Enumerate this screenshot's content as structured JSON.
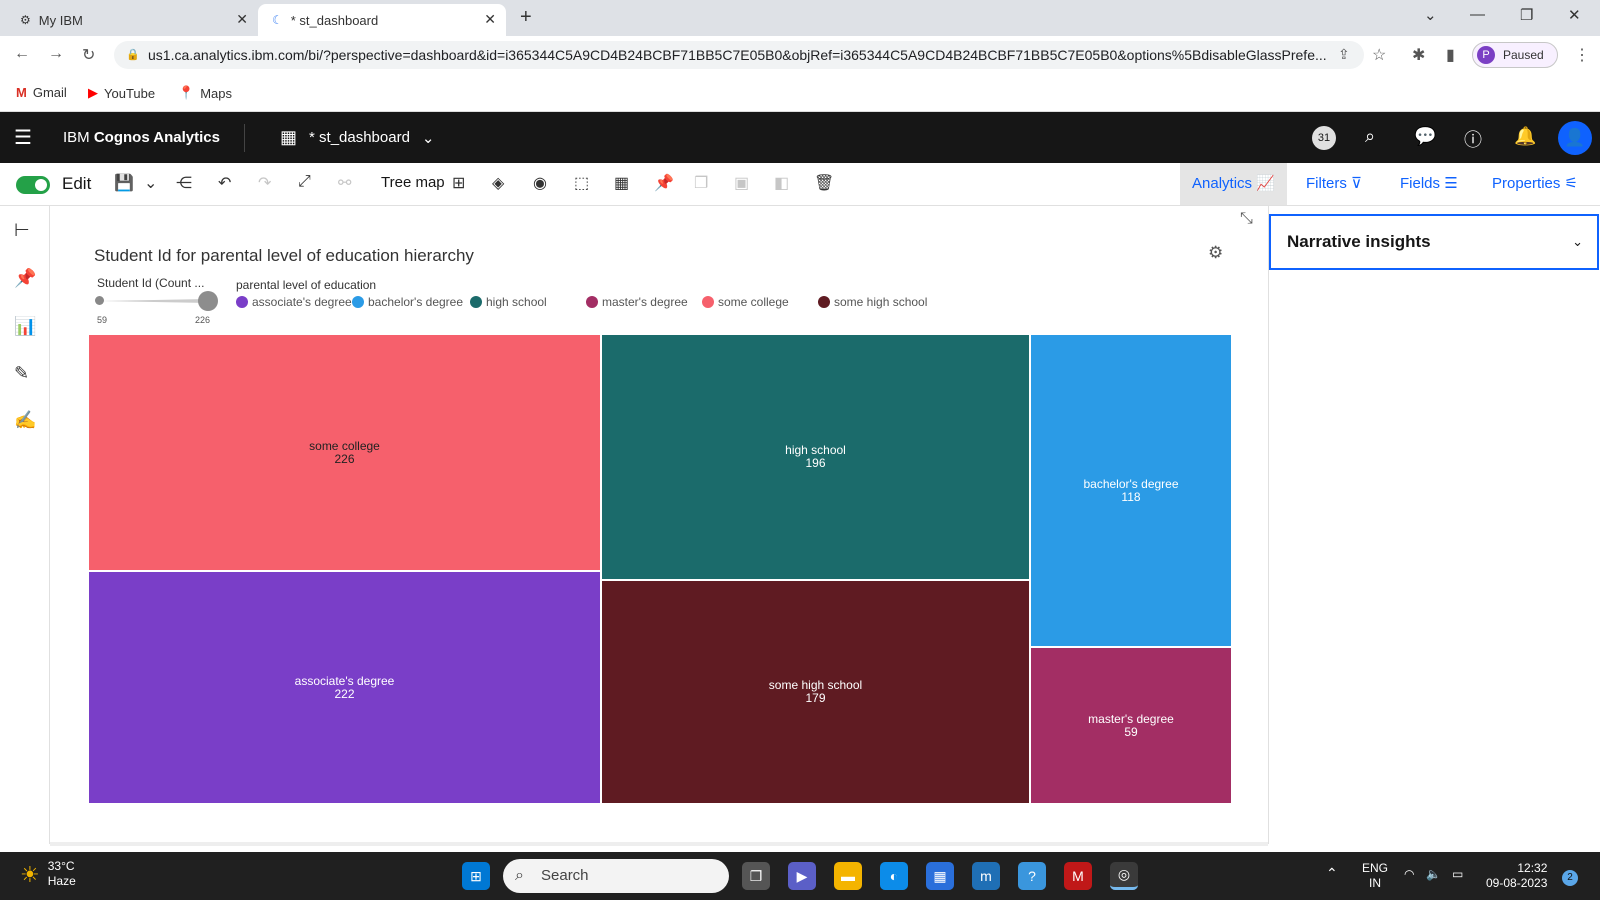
{
  "browser": {
    "tabs": [
      {
        "title": "My IBM"
      },
      {
        "title": "* st_dashboard"
      }
    ],
    "url": "us1.ca.analytics.ibm.com/bi/?perspective=dashboard&id=i365344C5A9CD4B24BCBF71BB5C7E05B0&objRef=i365344C5A9CD4B24BCBF71BB5C7E05B0&options%5BdisableGlassPrefe...",
    "profile_initial": "P",
    "profile_status": "Paused",
    "bookmarks": [
      "Gmail",
      "YouTube",
      "Maps"
    ]
  },
  "app": {
    "brand_prefix": "IBM ",
    "brand_name": "Cognos Analytics",
    "dashboard_name": "* st_dashboard",
    "badge": "31"
  },
  "toolbar": {
    "edit_label": "Edit",
    "chart_type": "Tree map",
    "tabs": [
      "Analytics",
      "Filters",
      "Fields",
      "Properties"
    ]
  },
  "chart_data": {
    "type": "treemap",
    "title": "Student Id for parental level of education hierarchy",
    "size_label": "Student Id (Count ...",
    "size_min": "59",
    "size_max": "226",
    "color_label": "parental level of education",
    "legend": [
      {
        "name": "associate's degree",
        "color": "#7a3ec8"
      },
      {
        "name": "bachelor's degree",
        "color": "#2b9be6"
      },
      {
        "name": "high school",
        "color": "#1b6b6b"
      },
      {
        "name": "master's degree",
        "color": "#a32e64"
      },
      {
        "name": "some college",
        "color": "#f6606c"
      },
      {
        "name": "some high school",
        "color": "#5f1b22"
      }
    ],
    "cells": [
      {
        "label": "some college",
        "value": 226,
        "color": "#f6606c"
      },
      {
        "label": "associate's degree",
        "value": 222,
        "color": "#7a3ec8"
      },
      {
        "label": "high school",
        "value": 196,
        "color": "#1b6b6b"
      },
      {
        "label": "some high school",
        "value": 179,
        "color": "#5f1b22"
      },
      {
        "label": "bachelor's degree",
        "value": 118,
        "color": "#2b9be6"
      },
      {
        "label": "master's degree",
        "value": 59,
        "color": "#a32e64"
      }
    ]
  },
  "right_panel": {
    "narrative_title": "Narrative insights"
  },
  "taskbar": {
    "temperature": "33°C",
    "weather": "Haze",
    "search_placeholder": "Search",
    "lang_1": "ENG",
    "lang_2": "IN",
    "time": "12:32",
    "date": "09-08-2023",
    "notifications": "2"
  }
}
